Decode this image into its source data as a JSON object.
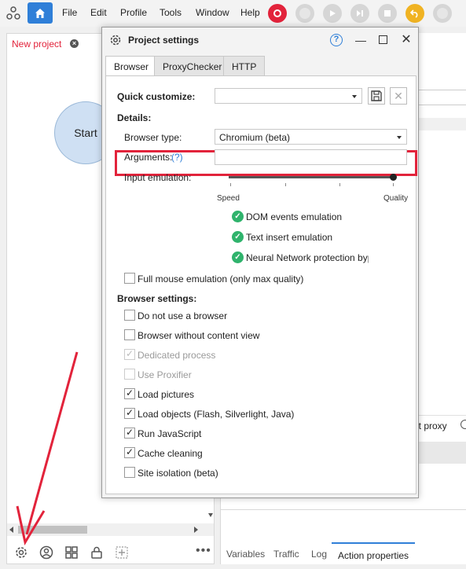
{
  "topbar": {
    "menu": [
      "File",
      "Edit",
      "Profile",
      "Tools",
      "Window",
      "Help"
    ]
  },
  "project_tab": {
    "label": "New project"
  },
  "canvas": {
    "start_node": "Start"
  },
  "right_panel": {
    "proxy_label": "ut proxy"
  },
  "bottom_tabs": [
    "Variables",
    "Traffic",
    "Log",
    "Action properties"
  ],
  "dialog": {
    "title": "Project settings",
    "help": "?",
    "tabs": [
      "Browser",
      "ProxyChecker",
      "HTTP"
    ],
    "quick_customize_label": "Quick customize:",
    "quick_customize_value": "",
    "details_label": "Details:",
    "browser_type_label": "Browser type:",
    "browser_type_value": "Chromium (beta)",
    "arguments_label": "Arguments:",
    "arguments_help": "(?)",
    "arguments_value": "",
    "input_emulation_label": "Input emulation:",
    "slider_min_label": "Speed",
    "slider_max_label": "Quality",
    "slider_level": 1.0,
    "emulation_features": [
      "DOM events emulation",
      "Text insert emulation",
      "Neural Network protection bypas"
    ],
    "full_mouse_label": "Full mouse emulation (only max quality)",
    "full_mouse_checked": false,
    "browser_settings_label": "Browser settings:",
    "browser_settings": [
      {
        "label": "Do not use a browser",
        "checked": false,
        "disabled": false
      },
      {
        "label": "Browser without content view",
        "checked": false,
        "disabled": false
      },
      {
        "label": "Dedicated process",
        "checked": true,
        "disabled": true
      },
      {
        "label": "Use Proxifier",
        "checked": false,
        "disabled": true
      },
      {
        "label": "Load pictures",
        "checked": true,
        "disabled": false
      },
      {
        "label": "Load objects (Flash, Silverlight, Java)",
        "checked": true,
        "disabled": false
      },
      {
        "label": "Run JavaScript",
        "checked": true,
        "disabled": false
      },
      {
        "label": "Cache cleaning",
        "checked": true,
        "disabled": false
      },
      {
        "label": "Site isolation (beta)",
        "checked": false,
        "disabled": false
      }
    ]
  },
  "colors": {
    "accent": "#2f7fd8",
    "highlight": "#e2233b",
    "success": "#2fb36c",
    "record": "#e2233b",
    "undo": "#f0b323"
  }
}
